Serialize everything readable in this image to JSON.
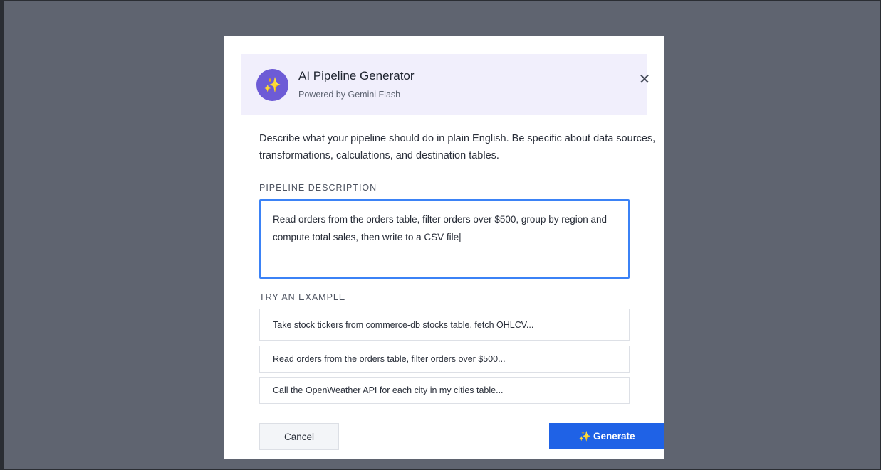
{
  "modal": {
    "title": "AI Pipeline Generator",
    "subtitle": "Powered by Gemini Flash",
    "avatar_glyph": "✨",
    "close_glyph": "✕",
    "description": "Describe what your pipeline should do in plain English. Be specific about data sources, transformations, calculations, and destination tables.",
    "pipeline_label": "PIPELINE DESCRIPTION",
    "pipeline_value": "Read orders from the orders table, filter orders over $500, group by region and compute total sales, then write to a CSV file|",
    "examples_label": "TRY AN EXAMPLE",
    "examples": [
      "Take stock tickers from commerce-db stocks table, fetch OHLCV...",
      "Read orders from the orders table, filter orders over $500...",
      "Call the OpenWeather API for each city in my cities table..."
    ],
    "cancel_label": "Cancel",
    "generate_label": "✨ Generate"
  },
  "colors": {
    "overlay": "#5f6470",
    "header_bg": "#f1effc",
    "avatar_bg": "#6d5bd6",
    "focus_border": "#3b82f6",
    "primary": "#1f62e6"
  }
}
